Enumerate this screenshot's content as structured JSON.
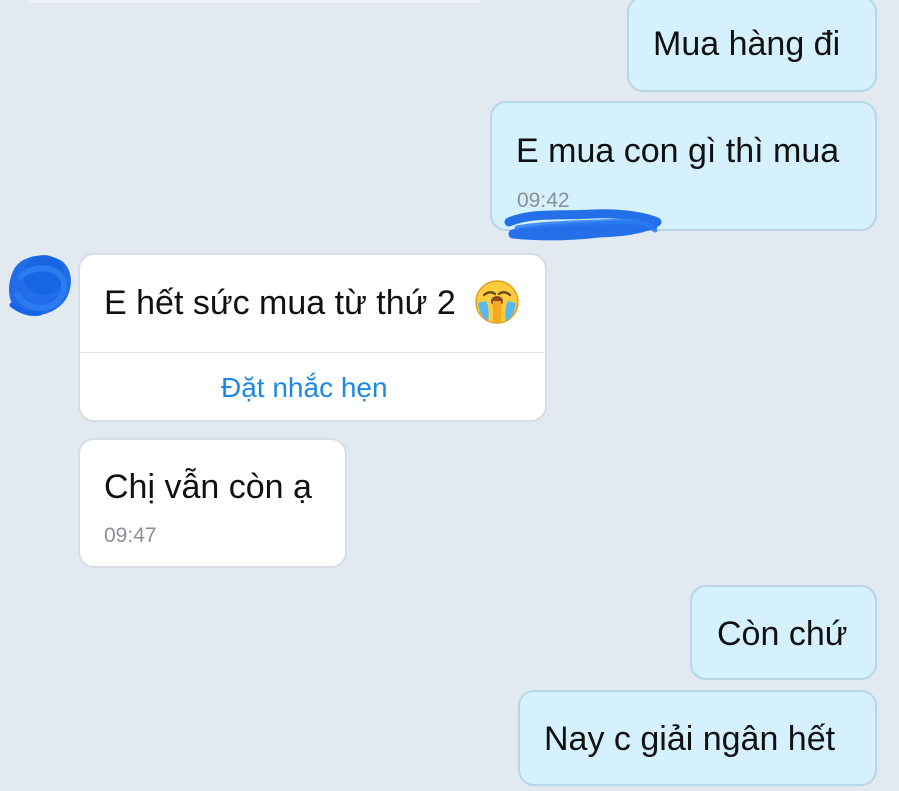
{
  "colors": {
    "background": "#E2E9F1",
    "outgoing_bubble": "#D5F1FE",
    "incoming_bubble": "#FFFFFF",
    "link": "#1E88E5",
    "timestamp": "#8A9096",
    "redaction_scribble": "#1565E8"
  },
  "messages": [
    {
      "direction": "out",
      "text": "Mua hàng đi"
    },
    {
      "direction": "out",
      "text": "E mua con gì thì mua",
      "time": "09:42"
    },
    {
      "direction": "in",
      "text": "E hết sức mua từ thứ 2",
      "emoji": "crying-face-emoji",
      "action": "Đặt nhắc hẹn"
    },
    {
      "direction": "in",
      "text": "Chị vẫn còn ạ",
      "time": "09:47"
    },
    {
      "direction": "out",
      "text": "Còn chứ"
    },
    {
      "direction": "out",
      "text": "Nay c giải ngân hết"
    }
  ],
  "sender_avatar": {
    "icon": "redacted-avatar"
  }
}
